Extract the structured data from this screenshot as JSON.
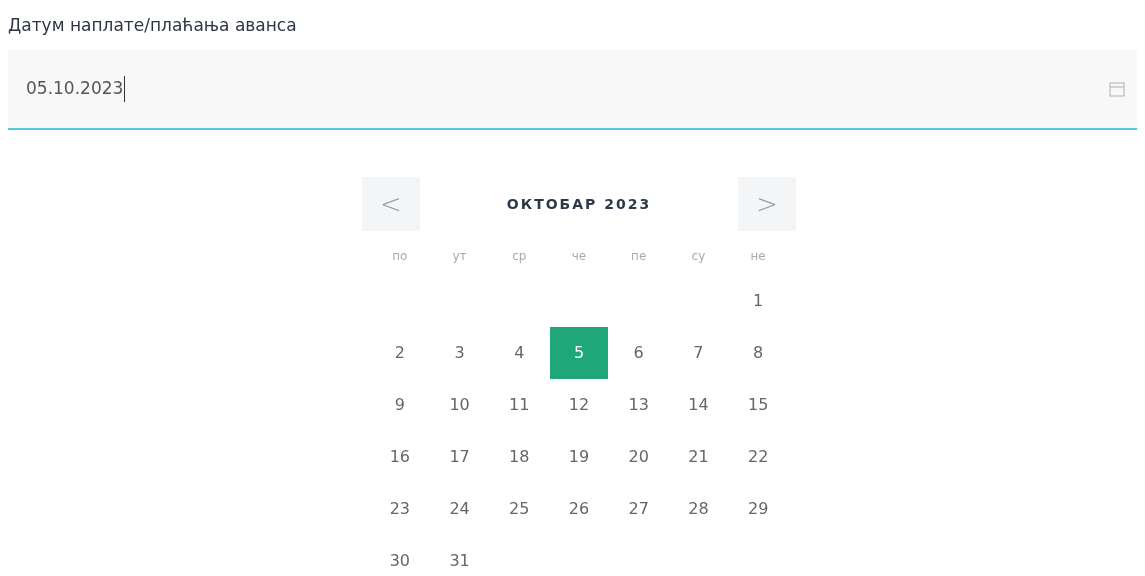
{
  "field": {
    "label": "Датум наплате/плаћања аванса",
    "value": "05.10.2023"
  },
  "calendar": {
    "prev": "<",
    "title": "ОКТОБАР 2023",
    "next": ">",
    "weekdays": [
      "по",
      "ут",
      "ср",
      "че",
      "пе",
      "су",
      "не"
    ],
    "weeks": [
      [
        {
          "day": "1",
          "selected": false
        }
      ],
      [
        {
          "day": "2",
          "selected": false
        },
        {
          "day": "3",
          "selected": false
        },
        {
          "day": "4",
          "selected": false
        },
        {
          "day": "5",
          "selected": true
        },
        {
          "day": "6",
          "selected": false
        },
        {
          "day": "7",
          "selected": false
        },
        {
          "day": "8",
          "selected": false
        }
      ],
      [
        {
          "day": "9",
          "selected": false
        },
        {
          "day": "10",
          "selected": false
        },
        {
          "day": "11",
          "selected": false
        },
        {
          "day": "12",
          "selected": false
        },
        {
          "day": "13",
          "selected": false
        },
        {
          "day": "14",
          "selected": false
        },
        {
          "day": "15",
          "selected": false
        }
      ],
      [
        {
          "day": "16",
          "selected": false
        },
        {
          "day": "17",
          "selected": false
        },
        {
          "day": "18",
          "selected": false
        },
        {
          "day": "19",
          "selected": false
        },
        {
          "day": "20",
          "selected": false
        },
        {
          "day": "21",
          "selected": false
        },
        {
          "day": "22",
          "selected": false
        }
      ],
      [
        {
          "day": "23",
          "selected": false
        },
        {
          "day": "24",
          "selected": false
        },
        {
          "day": "25",
          "selected": false
        },
        {
          "day": "26",
          "selected": false
        },
        {
          "day": "27",
          "selected": false
        },
        {
          "day": "28",
          "selected": false
        },
        {
          "day": "29",
          "selected": false
        }
      ],
      [
        {
          "day": "30",
          "selected": false
        },
        {
          "day": "31",
          "selected": false
        }
      ]
    ]
  }
}
